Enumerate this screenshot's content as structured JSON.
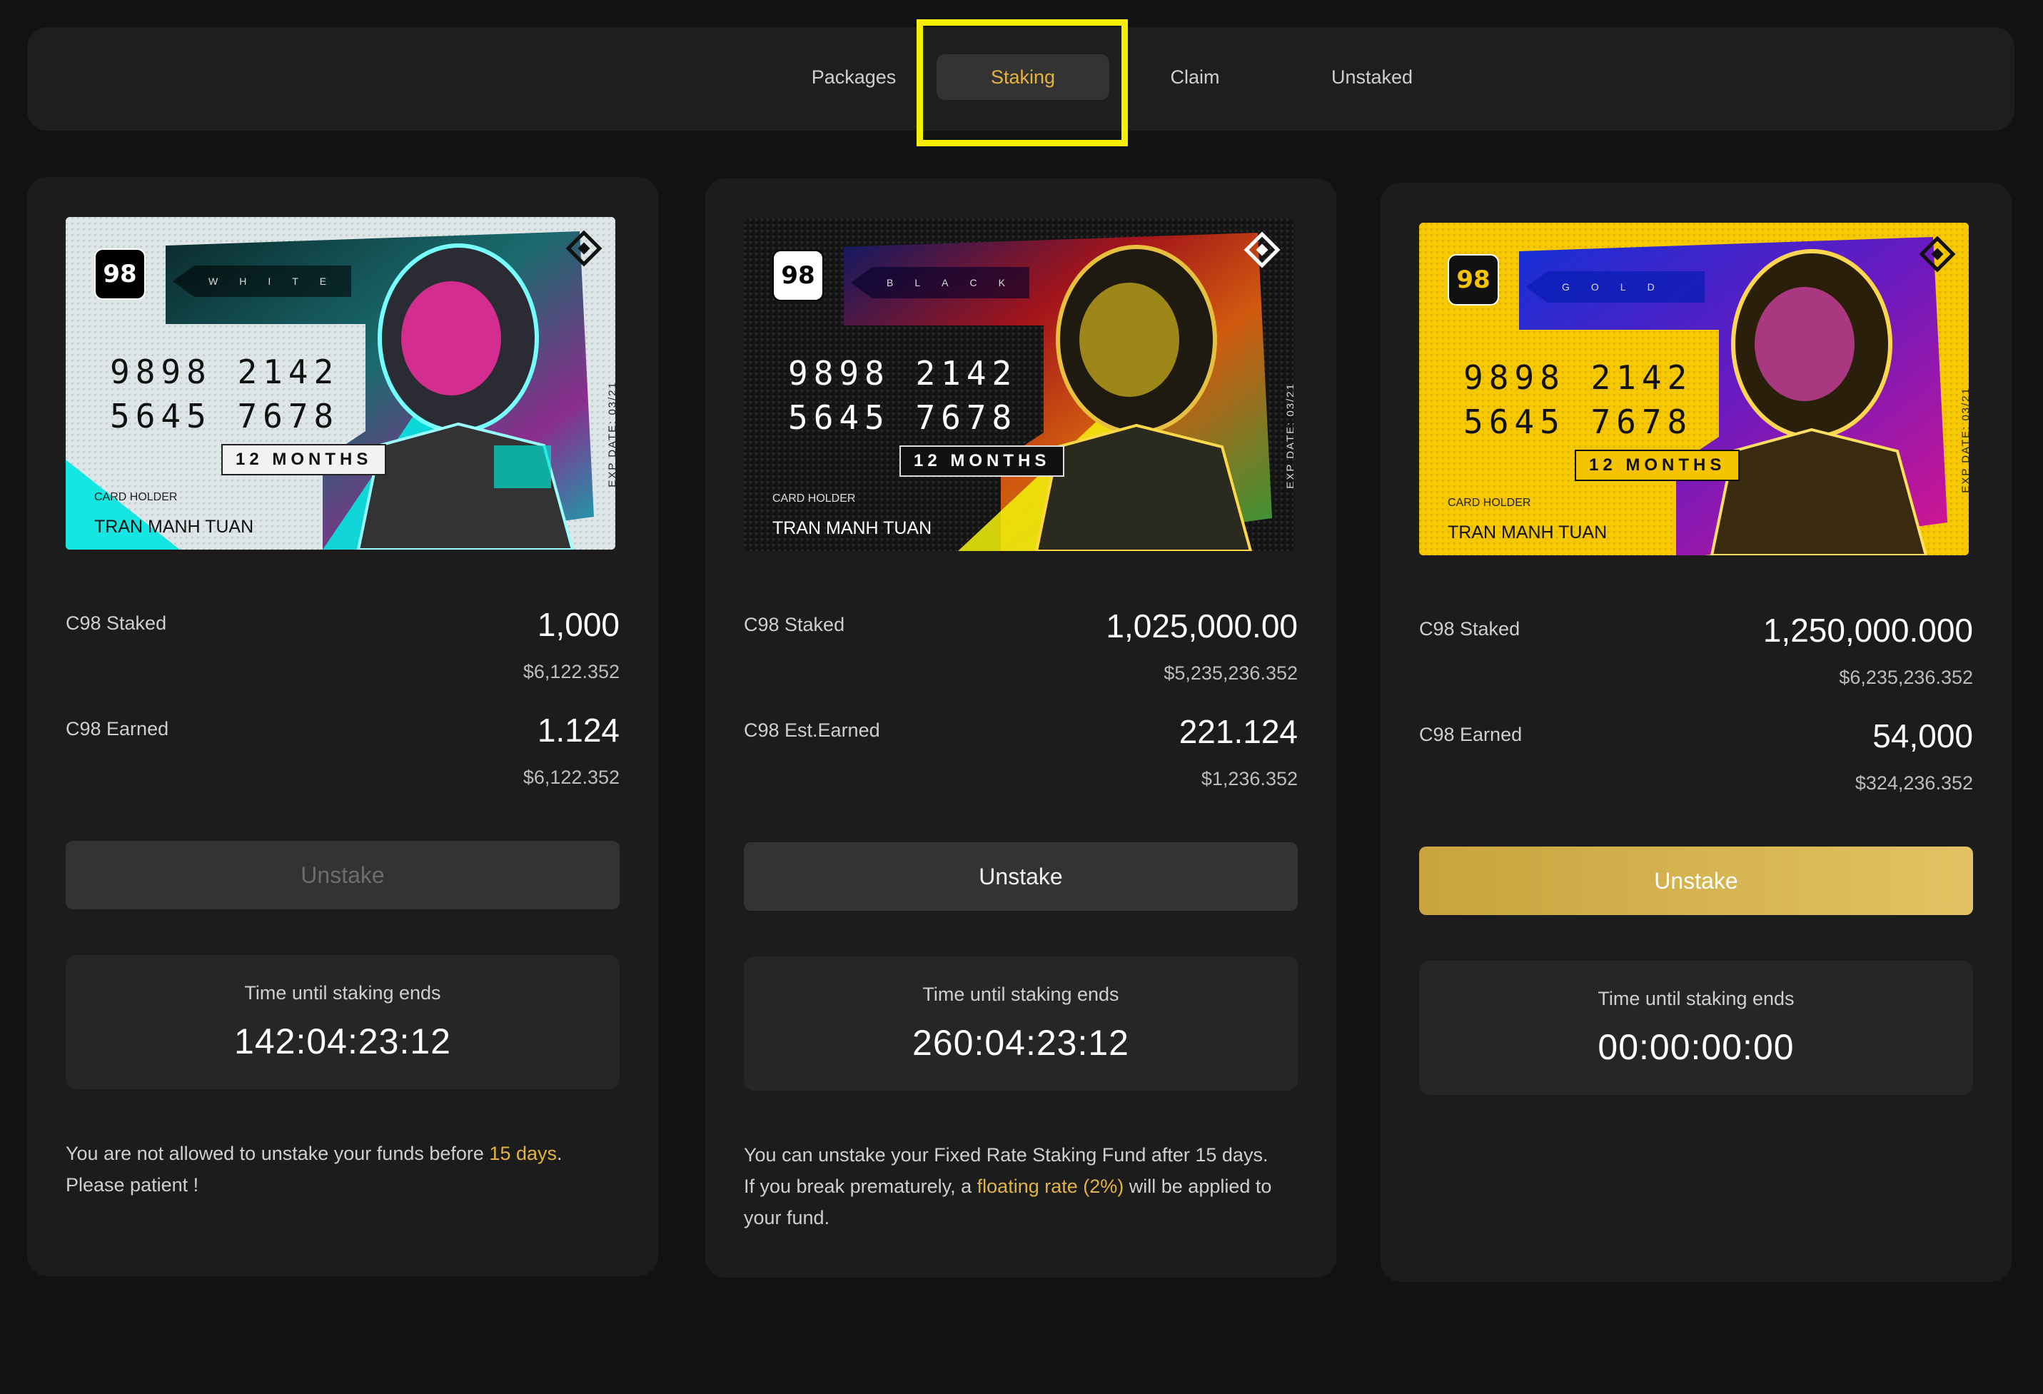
{
  "tabs": [
    {
      "label": "Packages",
      "active": false
    },
    {
      "label": "Staking",
      "active": true
    },
    {
      "label": "Claim",
      "active": false
    },
    {
      "label": "Unstaked",
      "active": false
    }
  ],
  "colors": {
    "background": "#121212",
    "panel": "#1c1c1c",
    "accent": "#e3b341",
    "highlight": "#f5ee00"
  },
  "cards": [
    {
      "tier": "WHITE",
      "logo": "98",
      "number_line1": "9898 2142",
      "number_line2": "5645 7678",
      "months": "12 MONTHS",
      "holder_label": "CARD HOLDER",
      "holder": "TRAN MANH TUAN",
      "exp": "EXP DATE: 03/21",
      "staked_label": "C98 Staked",
      "staked_value": "1,000",
      "staked_usd": "$6,122.352",
      "earned_label": "C98 Earned",
      "earned_value": "1.124",
      "earned_usd": "$6,122.352",
      "button": "Unstake",
      "button_state": "disabled",
      "timer_label": "Time until staking ends",
      "timer_value": "142:04:23:12",
      "note_a": "You are not allowed to unstake your funds before ",
      "note_hl": "15 days",
      "note_b": ".",
      "note_c": "Please patient !"
    },
    {
      "tier": "BLACK",
      "logo": "98",
      "number_line1": "9898 2142",
      "number_line2": "5645 7678",
      "months": "12 MONTHS",
      "holder_label": "CARD HOLDER",
      "holder": "TRAN MANH TUAN",
      "exp": "EXP DATE: 03/21",
      "staked_label": "C98 Staked",
      "staked_value": "1,025,000.00",
      "staked_usd": "$5,235,236.352",
      "earned_label": "C98 Est.Earned",
      "earned_value": "221.124",
      "earned_usd": "$1,236.352",
      "button": "Unstake",
      "button_state": "normal",
      "timer_label": "Time until staking ends",
      "timer_value": "260:04:23:12",
      "note_a": "You can unstake your Fixed Rate Staking Fund after 15 days.",
      "note_b": "If you break prematurely, a ",
      "note_hl": "floating rate (2%)",
      "note_c": " will be applied to your fund."
    },
    {
      "tier": "GOLD",
      "logo": "98",
      "number_line1": "9898 2142",
      "number_line2": "5645 7678",
      "months": "12 MONTHS",
      "holder_label": "CARD HOLDER",
      "holder": "TRAN MANH TUAN",
      "exp": "EXP DATE: 03/21",
      "staked_label": "C98 Staked",
      "staked_value": "1,250,000.000",
      "staked_usd": "$6,235,236.352",
      "earned_label": "C98 Earned",
      "earned_value": "54,000",
      "earned_usd": "$324,236.352",
      "button": "Unstake",
      "button_state": "gold",
      "timer_label": "Time until staking ends",
      "timer_value": "00:00:00:00"
    }
  ]
}
